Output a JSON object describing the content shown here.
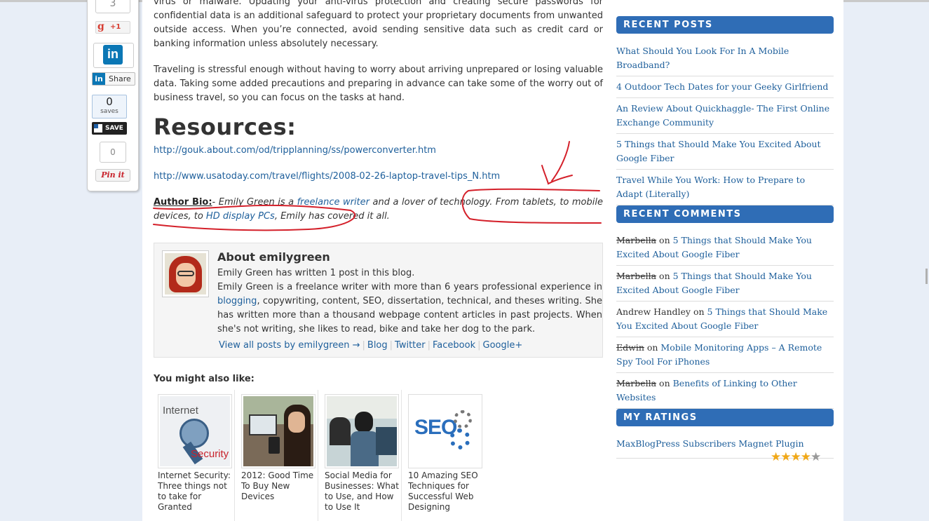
{
  "share": {
    "top_count": "3",
    "gplus_label": "+1",
    "gplus_glyph": "g",
    "linkedin_glyph": "in",
    "linkedin_share": "Share",
    "saves_count": "0",
    "saves_label": "saves",
    "save_button": "SAVE",
    "pin_count": "0",
    "pin_label": "Pin it"
  },
  "article": {
    "para1": "virus or malware. Updating your anti-virus protection and creating secure passwords for confidential data is an additional safeguard to protect your proprietary documents from unwanted outside access. When you’re connected, avoid sending sensitive data such as credit card or banking information unless absolutely necessary.",
    "para2": "Traveling is stressful enough without having to worry about arriving unprepared or losing valuable data. Taking some added precautions and preparing in advance can take some of the worry out of business travel, so you can focus on the tasks at hand.",
    "resources_heading": "Resources:",
    "link1": "http://gouk.about.com/od/tripplanning/ss/powerconverter.htm",
    "link2": "http://www.usatoday.com/travel/flights/2008-02-26-laptop-travel-tips_N.htm",
    "bio_label": "Author Bio:",
    "bio_dash": "- ",
    "bio_t1": "Emily Green is a ",
    "bio_link1": "freelance writer",
    "bio_t2": " and a lover of technology. From tablets, to mobile devices, to ",
    "bio_link2": "HD display PCs",
    "bio_t3": ", Emily has covered it all."
  },
  "about": {
    "title": "About emilygreen",
    "line1": "Emily Green has written 1 post in this blog.",
    "desc1": "Emily Green is a freelance writer with more than 6 years professional experience in ",
    "desc_link": "blogging",
    "desc2": ", copywriting, content, SEO, dissertation, technical, and theses writing. She has written more than a thousand webpage content articles in past projects. When she's not writing, she likes to read, bike and take her dog to the park.",
    "view_all": "View all posts by emilygreen →",
    "blog": "Blog",
    "twitter": "Twitter",
    "facebook": "Facebook",
    "google": "Google+"
  },
  "related": {
    "heading": "You might also like:",
    "items": [
      {
        "title": "Internet Security: Three things not to take for Granted",
        "thumb_text1": "Internet",
        "thumb_text2": "Security"
      },
      {
        "title": "2012: Good Time To Buy New Devices"
      },
      {
        "title": "Social Media for Businesses: What to Use, and How to Use It"
      },
      {
        "title": "10 Amazing SEO Techniques for Successful Web Designing",
        "thumb_text1": "SEO"
      }
    ]
  },
  "sidebar": {
    "recent_posts_title": "RECENT POSTS",
    "recent_posts": [
      "What Should You Look For In A Mobile Broadband?",
      "4 Outdoor Tech Dates for your Geeky Girlfriend",
      "An Review About Quickhaggle- The First Online Exchange Community",
      "5 Things that Should Make You Excited About Google Fiber",
      "Travel While You Work: How to Prepare to Adapt (Literally)"
    ],
    "recent_comments_title": "RECENT COMMENTS",
    "recent_comments": [
      {
        "author": "Marbella",
        "on": " on ",
        "post": "5 Things that Should Make You Excited About Google Fiber"
      },
      {
        "author": "Marbella",
        "on": " on ",
        "post": "5 Things that Should Make You Excited About Google Fiber"
      },
      {
        "author": "Andrew Handley",
        "on": " on ",
        "post": "5 Things that Should Make You Excited About Google Fiber"
      },
      {
        "author": "Edwin",
        "on": " on ",
        "post": "Mobile Monitoring Apps – A Remote Spy Tool For iPhones"
      },
      {
        "author": "Marbella",
        "on": " on ",
        "post": "Benefits of Linking to Other Websites"
      }
    ],
    "my_ratings_title": "MY RATINGS",
    "rating_item": "MaxBlogPress Subscribers Magnet Plugin",
    "rating_value": 4,
    "rating_max": 5
  },
  "colors": {
    "widget_header": "#2f6db6",
    "link": "#1e5f9b",
    "annotation": "#d4202a"
  }
}
